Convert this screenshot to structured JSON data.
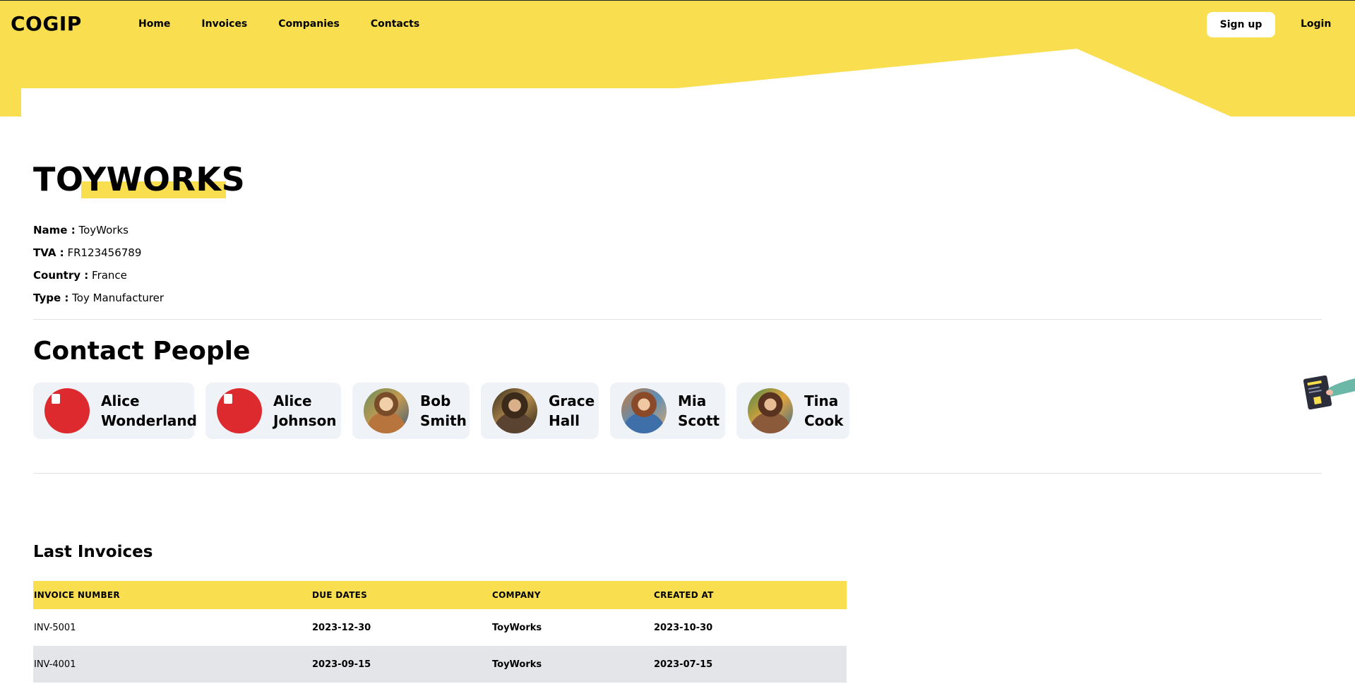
{
  "header": {
    "logo": "COGIP",
    "nav": [
      "Home",
      "Invoices",
      "Companies",
      "Contacts"
    ],
    "signup_label": "Sign up",
    "login_label": "Login",
    "accent_color": "#f9de4f"
  },
  "company": {
    "title": "TOYWORKS",
    "fields": [
      {
        "label": "Name :",
        "value": "ToyWorks"
      },
      {
        "label": "TVA :",
        "value": "FR123456789"
      },
      {
        "label": "Country :",
        "value": "France"
      },
      {
        "label": "Type :",
        "value": "Toy Manufacturer"
      }
    ]
  },
  "contacts": {
    "title": "Contact People",
    "people": [
      {
        "first": "Alice",
        "last": "Wonderland",
        "avatar": "broken-image-icon"
      },
      {
        "first": "Alice",
        "last": "Johnson",
        "avatar": "broken-image-icon"
      },
      {
        "first": "Bob",
        "last": "Smith",
        "avatar": "photo"
      },
      {
        "first": "Grace",
        "last": "Hall",
        "avatar": "photo"
      },
      {
        "first": "Mia",
        "last": "Scott",
        "avatar": "photo"
      },
      {
        "first": "Tina",
        "last": "Cook",
        "avatar": "photo"
      }
    ]
  },
  "invoices": {
    "title": "Last Invoices",
    "columns": [
      "INVOICE NUMBER",
      "DUE DATES",
      "COMPANY",
      "CREATED AT"
    ],
    "rows": [
      [
        "INV-5001",
        "2023-12-30",
        "ToyWorks",
        "2023-10-30"
      ],
      [
        "INV-4001",
        "2023-09-15",
        "ToyWorks",
        "2023-07-15"
      ]
    ]
  }
}
